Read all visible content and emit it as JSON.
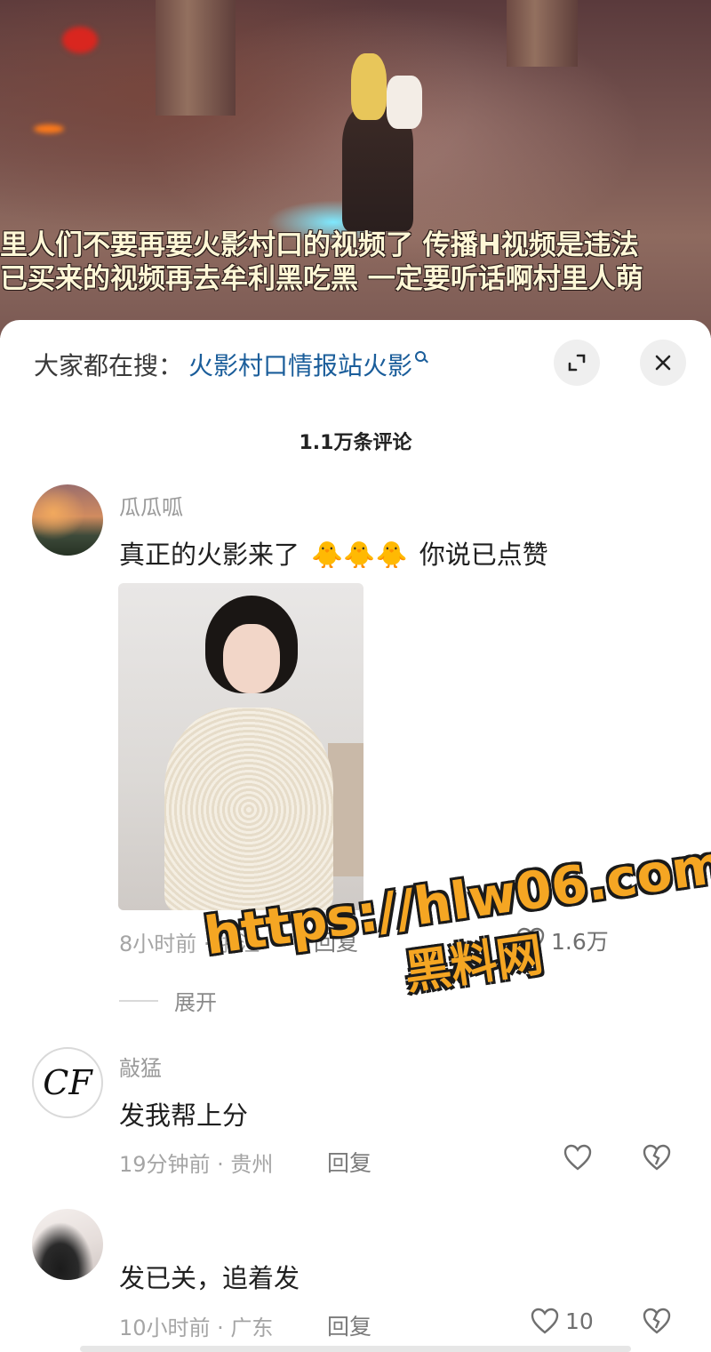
{
  "video": {
    "subtitle_line1": "里人们不要再要火影村口的视频了 传播H视频是违法",
    "subtitle_line2": "已买来的视频再去牟利黑吃黑 一定要听话啊村里人萌"
  },
  "search": {
    "prefix": "大家都在搜：",
    "query": "火影村口情报站火影"
  },
  "header": {
    "comment_count": "1.1万条评论"
  },
  "icons": {
    "expand": "expand-icon",
    "close": "close-icon",
    "search": "search-icon",
    "like": "heart-icon",
    "dislike": "broken-heart-icon"
  },
  "comments": [
    {
      "username": "瓜瓜呱",
      "text_before": "真正的火影来了",
      "text_after": "你说已点赞",
      "emoji": "🐥🐥🐥",
      "time_location": "8小时前 · 浙江",
      "reply": "回复",
      "likes": "1.6万"
    },
    {
      "username": "敲猛",
      "avatar_text": "CF",
      "text": "发我帮上分",
      "time_location": "19分钟前 · 贵州",
      "reply": "回复",
      "likes": ""
    },
    {
      "username": "",
      "text": "发已关，追着发",
      "time_location": "10小时前 · 广东",
      "reply": "回复",
      "likes": "10"
    }
  ],
  "expand_replies": "展开",
  "watermark": {
    "url": "https://hlw06.com",
    "name": "黑料网"
  },
  "colors": {
    "link_blue": "#1a5d9a",
    "watermark_orange": "#f5a623"
  }
}
